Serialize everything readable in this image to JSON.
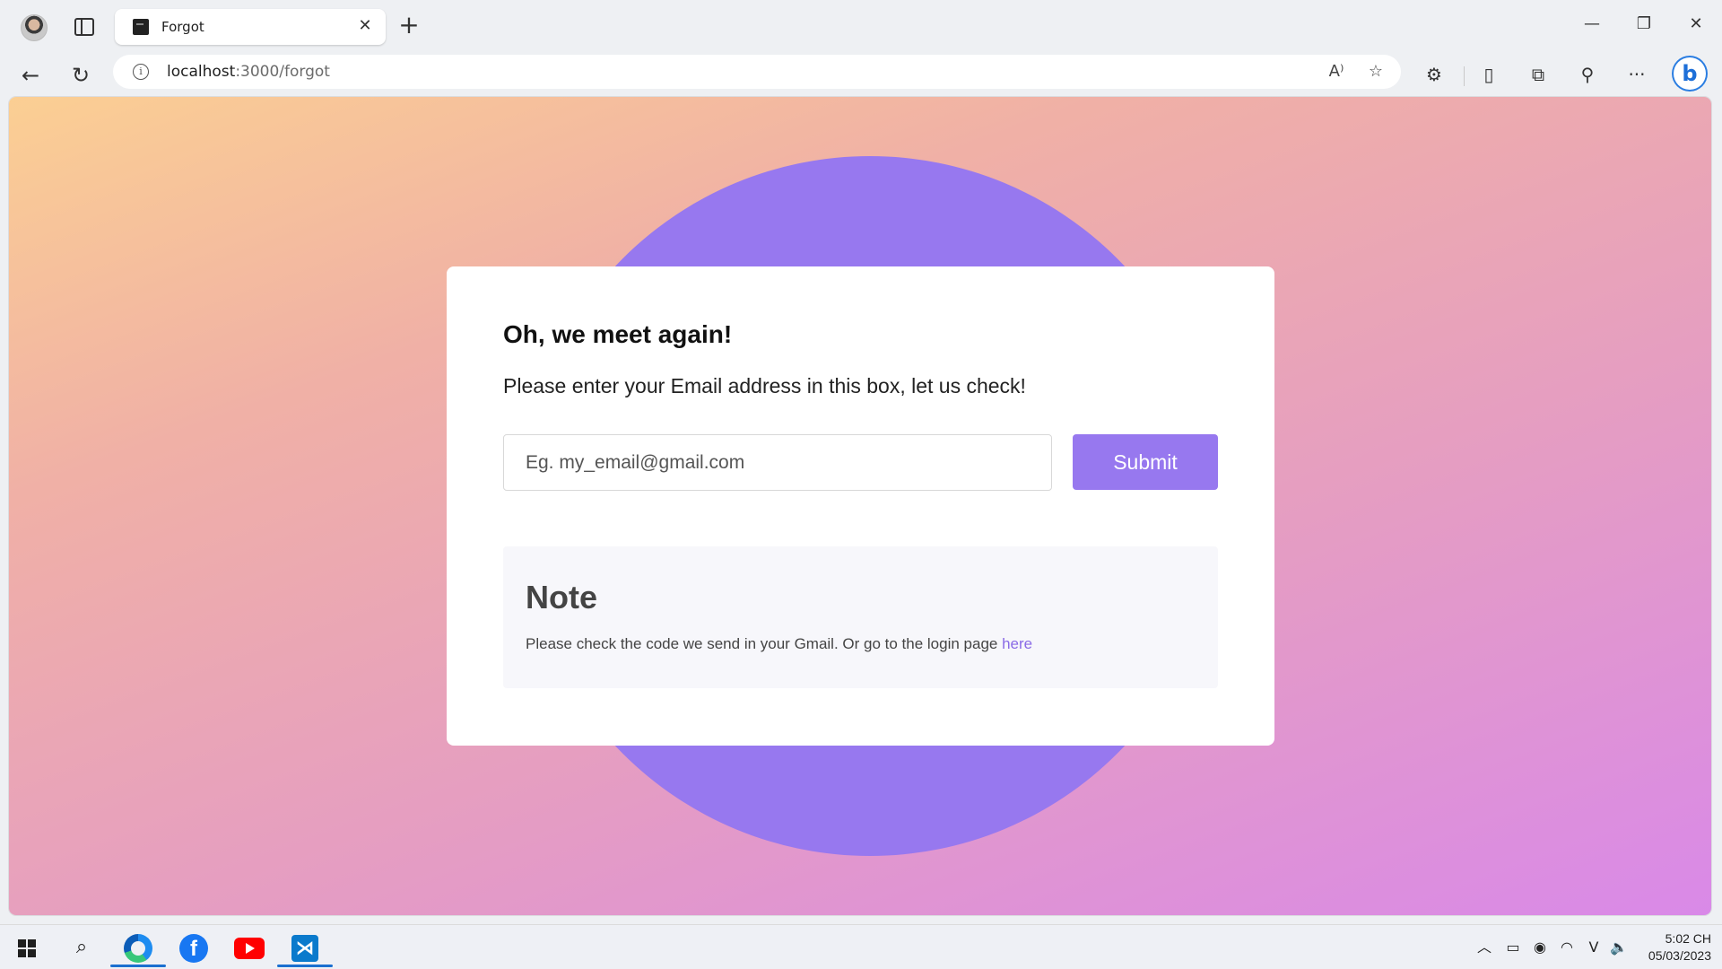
{
  "browser": {
    "tab": {
      "title": "Forgot",
      "close_glyph": "✕"
    },
    "new_tab_glyph": "+",
    "window_controls": {
      "minimize": "—",
      "restore": "❐",
      "close": "✕"
    },
    "address": {
      "host": "localhost",
      "path": ":3000/forgot"
    },
    "nav": {
      "back": "←",
      "reload": "↻"
    },
    "icons": {
      "read_aloud": "A⁾",
      "favorite": "☆",
      "extensions": "⚙",
      "split_screen": "▯",
      "collections": "⧉",
      "performance": "⚲",
      "more": "···",
      "bing": "b"
    }
  },
  "page": {
    "title": "Oh, we meet again!",
    "subtitle": "Please enter your Email address in this box, let us check!",
    "email_placeholder": "Eg. my_email@gmail.com",
    "submit_label": "Submit",
    "note": {
      "title": "Note",
      "text": "Please check the code we send in your Gmail. Or go to the login page ",
      "link_text": "here"
    },
    "colors": {
      "accent": "#9778ef",
      "link": "#8a6be6"
    }
  },
  "taskbar": {
    "apps": [
      "start",
      "search",
      "edge-dev",
      "facebook",
      "youtube",
      "vscode"
    ],
    "facebook_glyph": "f",
    "vscode_glyph": "⋊",
    "tray": {
      "chevron": "︿",
      "battery": "▭",
      "camera": "◉",
      "wifi": "◠",
      "vpn": "V",
      "volume": "🔈"
    },
    "clock": {
      "time": "5:02 CH",
      "date": "05/03/2023"
    }
  }
}
